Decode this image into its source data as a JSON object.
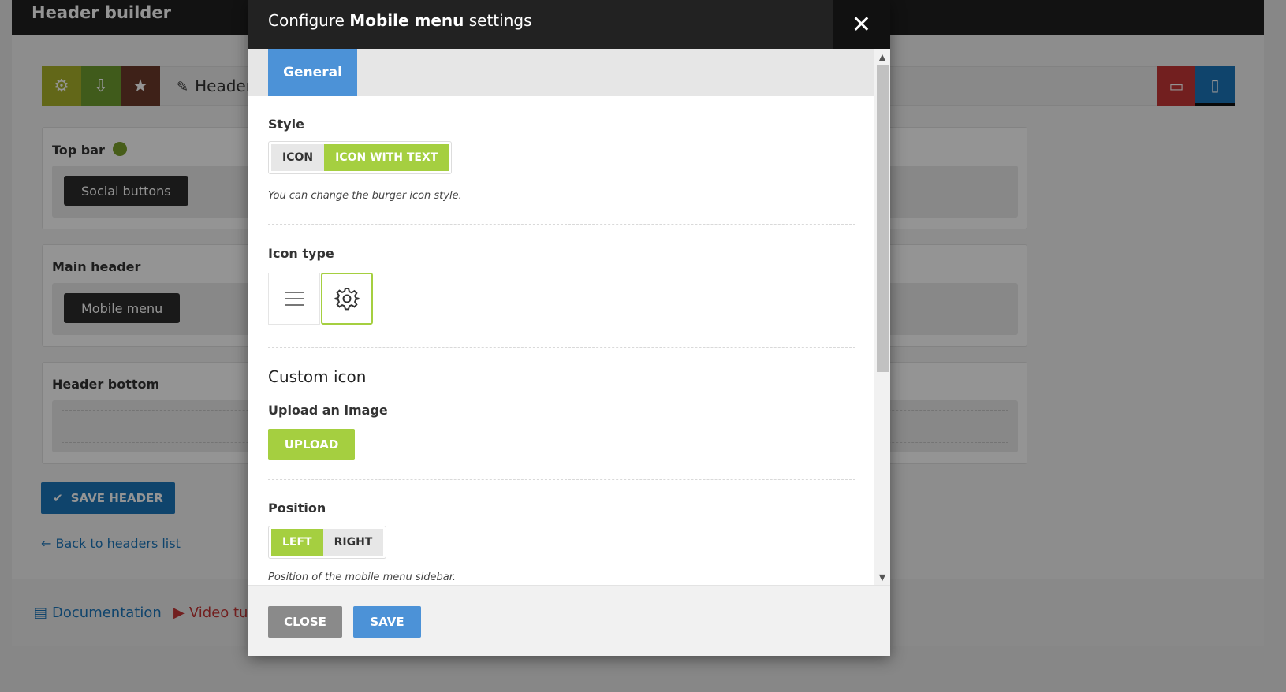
{
  "background": {
    "app_title": "Header builder",
    "header_name": "Header",
    "sections": [
      {
        "label": "Top bar",
        "element": "Social buttons"
      },
      {
        "label": "Main header",
        "element": "Mobile menu"
      },
      {
        "label": "Header bottom",
        "element": ""
      }
    ],
    "save_header_label": "SAVE HEADER",
    "back_link": "← Back to headers list",
    "footer": {
      "documentation": "Documentation",
      "video": "Video tu"
    },
    "colors": {
      "toolbar_settings": "#aab12a",
      "toolbar_import": "#6e9e2f",
      "toolbar_star": "#6b3a2a",
      "desktop_view": "#c43636",
      "mobile_view": "#1b75bb",
      "status_dot": "#7aa02c"
    }
  },
  "modal": {
    "title_prefix": "Configure",
    "title_bold": "Mobile menu",
    "title_suffix": "settings",
    "close_icon": "close-icon",
    "tabs": [
      {
        "label": "General",
        "active": true
      }
    ],
    "style": {
      "label": "Style",
      "options": [
        "ICON",
        "ICON WITH TEXT"
      ],
      "selected": "ICON WITH TEXT",
      "hint": "You can change the burger icon style."
    },
    "icon_type": {
      "label": "Icon type",
      "options": [
        "hamburger-icon",
        "gear-icon"
      ],
      "selected": "gear-icon"
    },
    "custom_icon": {
      "title": "Custom icon",
      "upload_label": "Upload an image",
      "upload_button": "UPLOAD"
    },
    "position": {
      "label": "Position",
      "options": [
        "LEFT",
        "RIGHT"
      ],
      "selected": "LEFT",
      "hint": "Position of the mobile menu sidebar."
    },
    "footer": {
      "close_label": "CLOSE",
      "save_label": "SAVE"
    },
    "colors": {
      "accent_green": "#a5cf40",
      "accent_blue": "#4c92d7",
      "header_bg": "#222222"
    }
  }
}
